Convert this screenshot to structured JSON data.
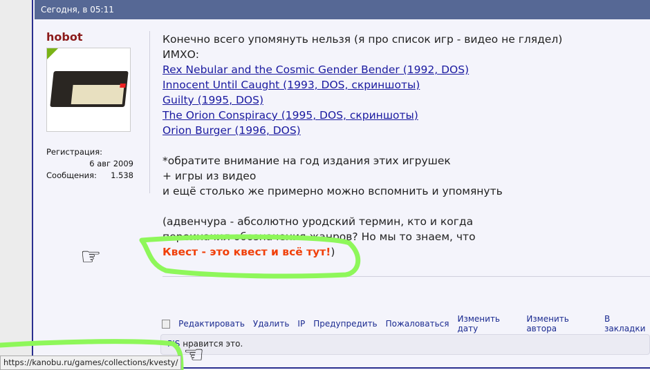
{
  "header": {
    "timestamp": "Сегодня, в 05:11"
  },
  "user": {
    "name": "hobot",
    "reg_label": "Регистрация:",
    "reg_date": "6 авг 2009",
    "posts_label": "Сообщения:",
    "posts_count": "1.538"
  },
  "post": {
    "line1": "Конечно всего упомянуть нельзя (я про список игр - видео не глядел)",
    "line2": "ИМХО:",
    "links": [
      "Rex Nebular and the Cosmic Gender Bender (1992, DOS)",
      "Innocent Until Caught (1993, DOS, скриншоты)",
      "Guilty (1995, DOS)",
      "The Orion Conspiracy (1995, DOS, скриншоты)",
      "Orion Burger (1996, DOS)"
    ],
    "note1": "*обратите внимание на год издания этих игрушек",
    "note2": "+ игры из видео",
    "note3": "и ещё столько же примерно можно вспомнить и упомянуть",
    "para1": "(адвенчура - абсолютно уродский термин, кто и когда",
    "para2": "переиначил обозначения жанров? Но мы то знаем, что",
    "highlight": "Квест - это квест и всё тут!",
    "close": ")"
  },
  "actions": [
    "Редактировать",
    "Удалить",
    "IP",
    "Предупредить",
    "Пожаловаться",
    "Изменить дату",
    "Изменить автора",
    "В закладки"
  ],
  "likes": {
    "user": "PIS",
    "text": " нравится это."
  },
  "statusbar": {
    "url": "https://kanobu.ru/games/collections/kvesty/"
  },
  "colors": {
    "header": "#566895",
    "highlight": "#f0400a",
    "annotation": "#8ef75a"
  }
}
